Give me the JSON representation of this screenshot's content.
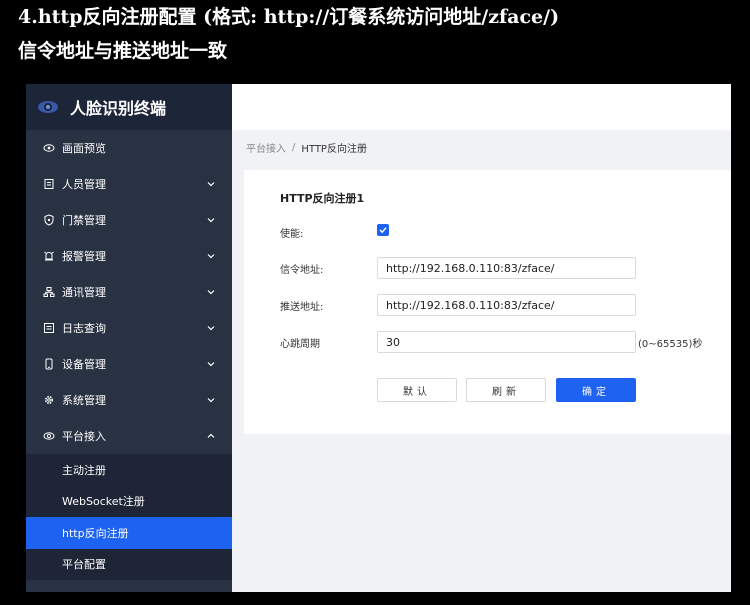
{
  "caption": {
    "line1": "4.http反向注册配置  (格式: http://订餐系统访问地址/zface/)",
    "line2": "信令地址与推送地址一致"
  },
  "app": {
    "title": "人脸识别终端",
    "logo_icon": "camera-icon"
  },
  "sidebar": {
    "items": [
      {
        "label": "画面预览",
        "icon": "eye-icon",
        "expandable": false
      },
      {
        "label": "人员管理",
        "icon": "person-card-icon",
        "expandable": true
      },
      {
        "label": "门禁管理",
        "icon": "shield-icon",
        "expandable": true
      },
      {
        "label": "报警管理",
        "icon": "alarm-icon",
        "expandable": true
      },
      {
        "label": "通讯管理",
        "icon": "network-icon",
        "expandable": true
      },
      {
        "label": "日志查询",
        "icon": "log-icon",
        "expandable": true
      },
      {
        "label": "设备管理",
        "icon": "device-icon",
        "expandable": true
      },
      {
        "label": "系统管理",
        "icon": "gear-icon",
        "expandable": true
      },
      {
        "label": "平台接入",
        "icon": "platform-icon",
        "expandable": true,
        "expanded": true
      }
    ],
    "submenu": [
      {
        "label": "主动注册",
        "active": false
      },
      {
        "label": "WebSocket注册",
        "active": false
      },
      {
        "label": "http反向注册",
        "active": true
      },
      {
        "label": "平台配置",
        "active": false
      }
    ]
  },
  "breadcrumb": {
    "parent": "平台接入",
    "separator": "/",
    "current": "HTTP反向注册"
  },
  "form": {
    "title": "HTTP反向注册1",
    "enable_label": "使能:",
    "enable_checked": true,
    "signal_label": "信令地址:",
    "signal_value": "http://192.168.0.110:83/zface/",
    "push_label": "推送地址:",
    "push_value": "http://192.168.0.110:83/zface/",
    "heartbeat_label": "心跳周期",
    "heartbeat_value": "30",
    "heartbeat_suffix": "(0~65535)秒"
  },
  "buttons": {
    "default_label": "默认",
    "refresh_label": "刷新",
    "confirm_label": "确定"
  },
  "colors": {
    "accent": "#1d62f0",
    "sidebar_bg": "#293243",
    "logo_bar_bg": "#1d2538"
  }
}
